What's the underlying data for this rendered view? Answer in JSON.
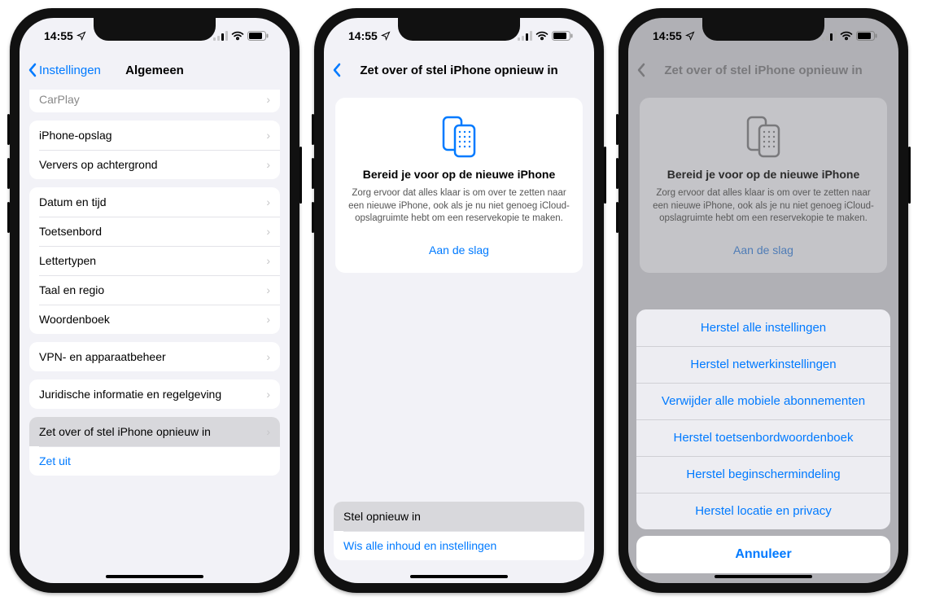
{
  "status": {
    "time": "14:55"
  },
  "phone1": {
    "back_label": "Instellingen",
    "title": "Algemeen",
    "group0": [
      {
        "label": "CarPlay"
      }
    ],
    "group1": [
      {
        "label": "iPhone-opslag"
      },
      {
        "label": "Ververs op achtergrond"
      }
    ],
    "group2": [
      {
        "label": "Datum en tijd"
      },
      {
        "label": "Toetsenbord"
      },
      {
        "label": "Lettertypen"
      },
      {
        "label": "Taal en regio"
      },
      {
        "label": "Woordenboek"
      }
    ],
    "group3": [
      {
        "label": "VPN- en apparaatbeheer"
      }
    ],
    "group4": [
      {
        "label": "Juridische informatie en regelgeving"
      }
    ],
    "group5": [
      {
        "label": "Zet over of stel iPhone opnieuw in"
      },
      {
        "label": "Zet uit"
      }
    ]
  },
  "phone2": {
    "title": "Zet over of stel iPhone opnieuw in",
    "card": {
      "heading": "Bereid je voor op de nieuwe iPhone",
      "body": "Zorg ervoor dat alles klaar is om over te zetten naar een nieuwe iPhone, ook als je nu niet genoeg iCloud-opslagruimte hebt om een reservekopie te maken.",
      "cta": "Aan de slag"
    },
    "bottom": [
      {
        "label": "Stel opnieuw in"
      },
      {
        "label": "Wis alle inhoud en instellingen"
      }
    ]
  },
  "phone3": {
    "title": "Zet over of stel iPhone opnieuw in",
    "card": {
      "heading": "Bereid je voor op de nieuwe iPhone",
      "body": "Zorg ervoor dat alles klaar is om over te zetten naar een nieuwe iPhone, ook als je nu niet genoeg iCloud-opslagruimte hebt om een reservekopie te maken.",
      "cta": "Aan de slag"
    },
    "sheet": {
      "options": [
        "Herstel alle instellingen",
        "Herstel netwerkinstellingen",
        "Verwijder alle mobiele abonnementen",
        "Herstel toetsenbordwoordenboek",
        "Herstel beginschermindeling",
        "Herstel locatie en privacy"
      ],
      "cancel": "Annuleer"
    }
  }
}
